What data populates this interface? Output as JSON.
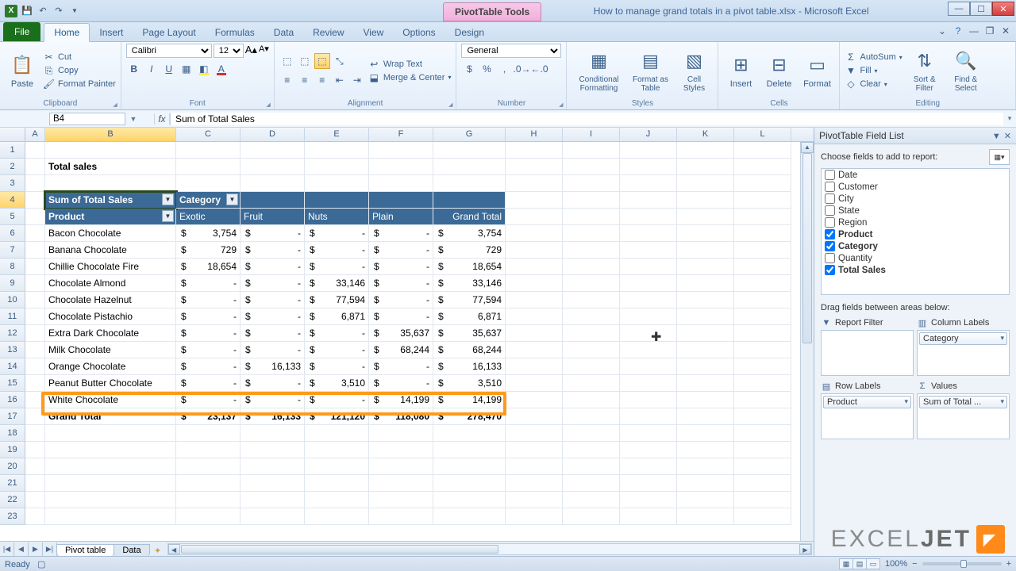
{
  "window": {
    "context_label": "PivotTable Tools",
    "doc_title": "How to manage grand totals in a pivot table.xlsx - Microsoft Excel"
  },
  "tabs": {
    "file": "File",
    "list": [
      "Home",
      "Insert",
      "Page Layout",
      "Formulas",
      "Data",
      "Review",
      "View",
      "Options",
      "Design"
    ],
    "active": "Home"
  },
  "ribbon": {
    "clipboard": {
      "label": "Clipboard",
      "paste": "Paste",
      "cut": "Cut",
      "copy": "Copy",
      "painter": "Format Painter"
    },
    "font": {
      "label": "Font",
      "name": "Calibri",
      "size": "12"
    },
    "alignment": {
      "label": "Alignment",
      "wrap": "Wrap Text",
      "merge": "Merge & Center"
    },
    "number": {
      "label": "Number",
      "format": "General"
    },
    "styles": {
      "label": "Styles",
      "cond": "Conditional Formatting",
      "table": "Format as Table",
      "cell": "Cell Styles"
    },
    "cells": {
      "label": "Cells",
      "insert": "Insert",
      "delete": "Delete",
      "format": "Format"
    },
    "editing": {
      "label": "Editing",
      "autosum": "AutoSum",
      "fill": "Fill",
      "clear": "Clear",
      "sort": "Sort & Filter",
      "find": "Find & Select"
    }
  },
  "namebox": "B4",
  "formula": "Sum of Total Sales",
  "title_cell": "Total sales",
  "pivot": {
    "corner": "Sum of Total Sales",
    "col_field": "Category",
    "row_field": "Product",
    "columns": [
      "Exotic",
      "Fruit",
      "Nuts",
      "Plain",
      "Grand Total"
    ],
    "rows": [
      {
        "p": "Bacon Chocolate",
        "v": [
          "3,754",
          "-",
          "-",
          "-",
          "3,754"
        ]
      },
      {
        "p": "Banana Chocolate",
        "v": [
          "729",
          "-",
          "-",
          "-",
          "729"
        ]
      },
      {
        "p": "Chillie Chocolate Fire",
        "v": [
          "18,654",
          "-",
          "-",
          "-",
          "18,654"
        ]
      },
      {
        "p": "Chocolate Almond",
        "v": [
          "-",
          "-",
          "33,146",
          "-",
          "33,146"
        ]
      },
      {
        "p": "Chocolate Hazelnut",
        "v": [
          "-",
          "-",
          "77,594",
          "-",
          "77,594"
        ]
      },
      {
        "p": "Chocolate Pistachio",
        "v": [
          "-",
          "-",
          "6,871",
          "-",
          "6,871"
        ]
      },
      {
        "p": "Extra Dark Chocolate",
        "v": [
          "-",
          "-",
          "-",
          "35,637",
          "35,637"
        ]
      },
      {
        "p": "Milk Chocolate",
        "v": [
          "-",
          "-",
          "-",
          "68,244",
          "68,244"
        ]
      },
      {
        "p": "Orange Chocolate",
        "v": [
          "-",
          "16,133",
          "-",
          "-",
          "16,133"
        ]
      },
      {
        "p": "Peanut Butter Chocolate",
        "v": [
          "-",
          "-",
          "3,510",
          "-",
          "3,510"
        ]
      },
      {
        "p": "White Chocolate",
        "v": [
          "-",
          "-",
          "-",
          "14,199",
          "14,199"
        ]
      }
    ],
    "grand": {
      "label": "Grand Total",
      "v": [
        "23,137",
        "16,133",
        "121,120",
        "118,080",
        "278,470"
      ]
    }
  },
  "fieldlist": {
    "title": "PivotTable Field List",
    "hint": "Choose fields to add to report:",
    "fields": [
      {
        "name": "Date",
        "checked": false
      },
      {
        "name": "Customer",
        "checked": false
      },
      {
        "name": "City",
        "checked": false
      },
      {
        "name": "State",
        "checked": false
      },
      {
        "name": "Region",
        "checked": false
      },
      {
        "name": "Product",
        "checked": true
      },
      {
        "name": "Category",
        "checked": true
      },
      {
        "name": "Quantity",
        "checked": false
      },
      {
        "name": "Total Sales",
        "checked": true
      }
    ],
    "drag_hint": "Drag fields between areas below:",
    "areas": {
      "filter": {
        "label": "Report Filter"
      },
      "columns": {
        "label": "Column Labels",
        "chip": "Category"
      },
      "rows": {
        "label": "Row Labels",
        "chip": "Product"
      },
      "values": {
        "label": "Values",
        "chip": "Sum of Total ..."
      }
    }
  },
  "sheets": {
    "active": "Pivot table",
    "other": "Data"
  },
  "status": {
    "ready": "Ready",
    "zoom": "100%"
  },
  "watermark": {
    "a": "EXCEL",
    "b": "JET"
  }
}
